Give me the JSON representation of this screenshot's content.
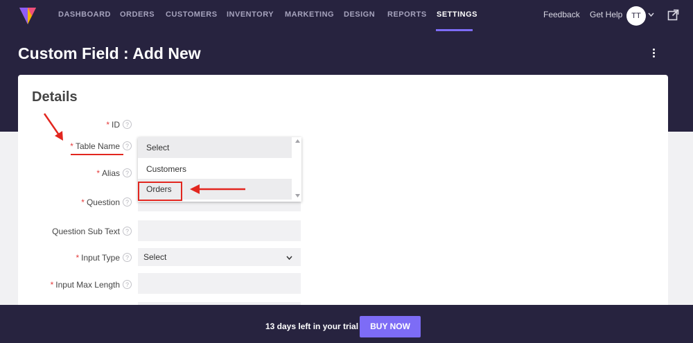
{
  "nav": {
    "items": [
      {
        "label": "DASHBOARD",
        "active": false
      },
      {
        "label": "ORDERS",
        "active": false
      },
      {
        "label": "CUSTOMERS",
        "active": false
      },
      {
        "label": "INVENTORY",
        "active": false
      },
      {
        "label": "MARKETING",
        "active": false
      },
      {
        "label": "DESIGN",
        "active": false
      },
      {
        "label": "REPORTS",
        "active": false
      },
      {
        "label": "SETTINGS",
        "active": true
      }
    ],
    "feedback": "Feedback",
    "get_help": "Get Help",
    "avatar_initials": "TT"
  },
  "page": {
    "title": "Custom Field : Add New",
    "section_title": "Details"
  },
  "form": {
    "required_mark": "*",
    "help_glyph": "?",
    "fields": [
      {
        "label": "ID",
        "required": true
      },
      {
        "label": "Table Name",
        "required": true,
        "value": "Select"
      },
      {
        "label": "Alias",
        "required": true
      },
      {
        "label": "Question",
        "required": true
      },
      {
        "label": "Question Sub Text",
        "required": false
      },
      {
        "label": "Input Type",
        "required": true,
        "value": "Select"
      },
      {
        "label": "Input Max Length",
        "required": true
      }
    ]
  },
  "dropdown": {
    "options": [
      "Select",
      "Customers",
      "Orders"
    ],
    "highlighted": "Customers"
  },
  "footer": {
    "trial_text": "13 days left in your trial",
    "buy_label": "BUY NOW"
  },
  "colors": {
    "nav_bg": "#27233f",
    "accent": "#7d6cf6",
    "annotation": "#e2261f",
    "required": "#e53b3b"
  }
}
